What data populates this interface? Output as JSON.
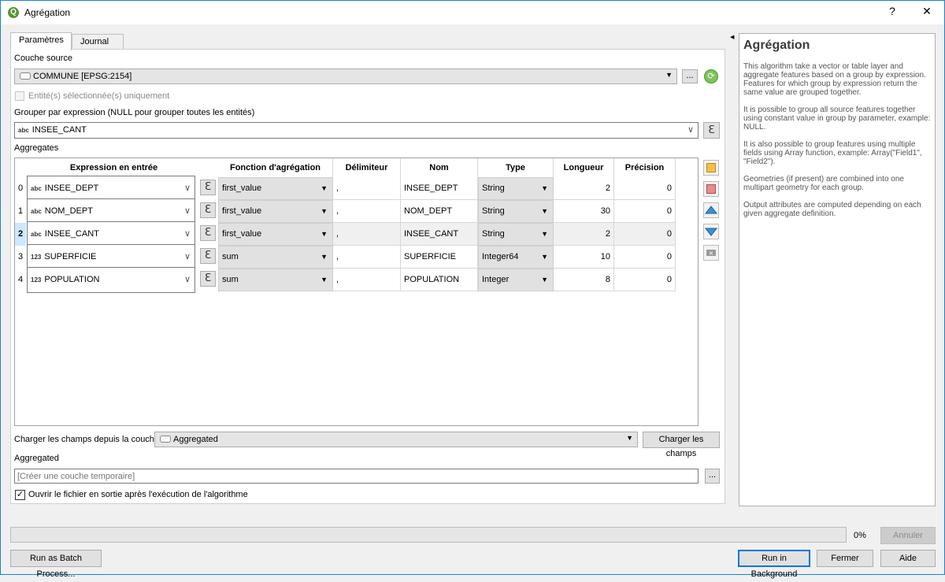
{
  "window": {
    "title": "Agrégation",
    "help_btn": "?",
    "close_btn": "✕"
  },
  "tabs": [
    {
      "label": "Paramètres"
    },
    {
      "label": "Journal"
    }
  ],
  "source": {
    "label": "Couche source",
    "value": "COMMUNE [EPSG:2154]",
    "browse": "...",
    "selected_only": "Entité(s) sélectionnée(s) uniquement"
  },
  "group_by": {
    "label": "Grouper par expression (NULL pour grouper toutes les entités)",
    "type": "abc",
    "value": "INSEE_CANT"
  },
  "aggregates": {
    "label": "Aggregates",
    "headers": [
      "Expression en entrée",
      "Fonction d'agrégation",
      "Délimiteur",
      "Nom",
      "Type",
      "Longueur",
      "Précision"
    ],
    "rows": [
      {
        "idx": "0",
        "etype": "abc",
        "expr": "INSEE_DEPT",
        "func": "first_value",
        "delim": ",",
        "name": "INSEE_DEPT",
        "type": "String",
        "len": "2",
        "prec": "0"
      },
      {
        "idx": "1",
        "etype": "abc",
        "expr": "NOM_DEPT",
        "func": "first_value",
        "delim": ",",
        "name": "NOM_DEPT",
        "type": "String",
        "len": "30",
        "prec": "0"
      },
      {
        "idx": "2",
        "etype": "abc",
        "expr": "INSEE_CANT",
        "func": "first_value",
        "delim": ",",
        "name": "INSEE_CANT",
        "type": "String",
        "len": "2",
        "prec": "0"
      },
      {
        "idx": "3",
        "etype": "123",
        "expr": "SUPERFICIE",
        "func": "sum",
        "delim": ",",
        "name": "SUPERFICIE",
        "type": "Integer64",
        "len": "10",
        "prec": "0"
      },
      {
        "idx": "4",
        "etype": "123",
        "expr": "POPULATION",
        "func": "sum",
        "delim": ",",
        "name": "POPULATION",
        "type": "Integer",
        "len": "8",
        "prec": "0"
      }
    ]
  },
  "load_fields": {
    "label": "Charger les champs depuis la couche",
    "value": "Aggregated",
    "button": "Charger les champs"
  },
  "output": {
    "label": "Aggregated",
    "placeholder": "[Créer une couche temporaire]",
    "browse": "...",
    "open_after": "Ouvrir le fichier en sortie après l'exécution de l'algorithme"
  },
  "help": {
    "title": "Agrégation",
    "paragraphs": [
      "This algorithm take a vector or table layer and aggregate features based on a group by expression. Features for which group by expression return the same value are grouped together.",
      "It is possible to group all source features together using constant value in group by parameter, example: NULL.",
      "It is also possible to group features using multiple fields using Array function, example: Array(\"Field1\", \"Field2\").",
      "Geometries (if present) are combined into one multipart geometry for each group.",
      "Output attributes are computed depending on each given aggregate definition."
    ]
  },
  "progress": {
    "value": 0,
    "text": "0%"
  },
  "buttons": {
    "cancel": "Annuler",
    "batch": "Run as Batch Process...",
    "background": "Run in Background",
    "close": "Fermer",
    "help": "Aide"
  },
  "colors": {
    "accent": "#0078d7",
    "selected_row": "#cde8ff",
    "qgis_green": "#589632"
  }
}
